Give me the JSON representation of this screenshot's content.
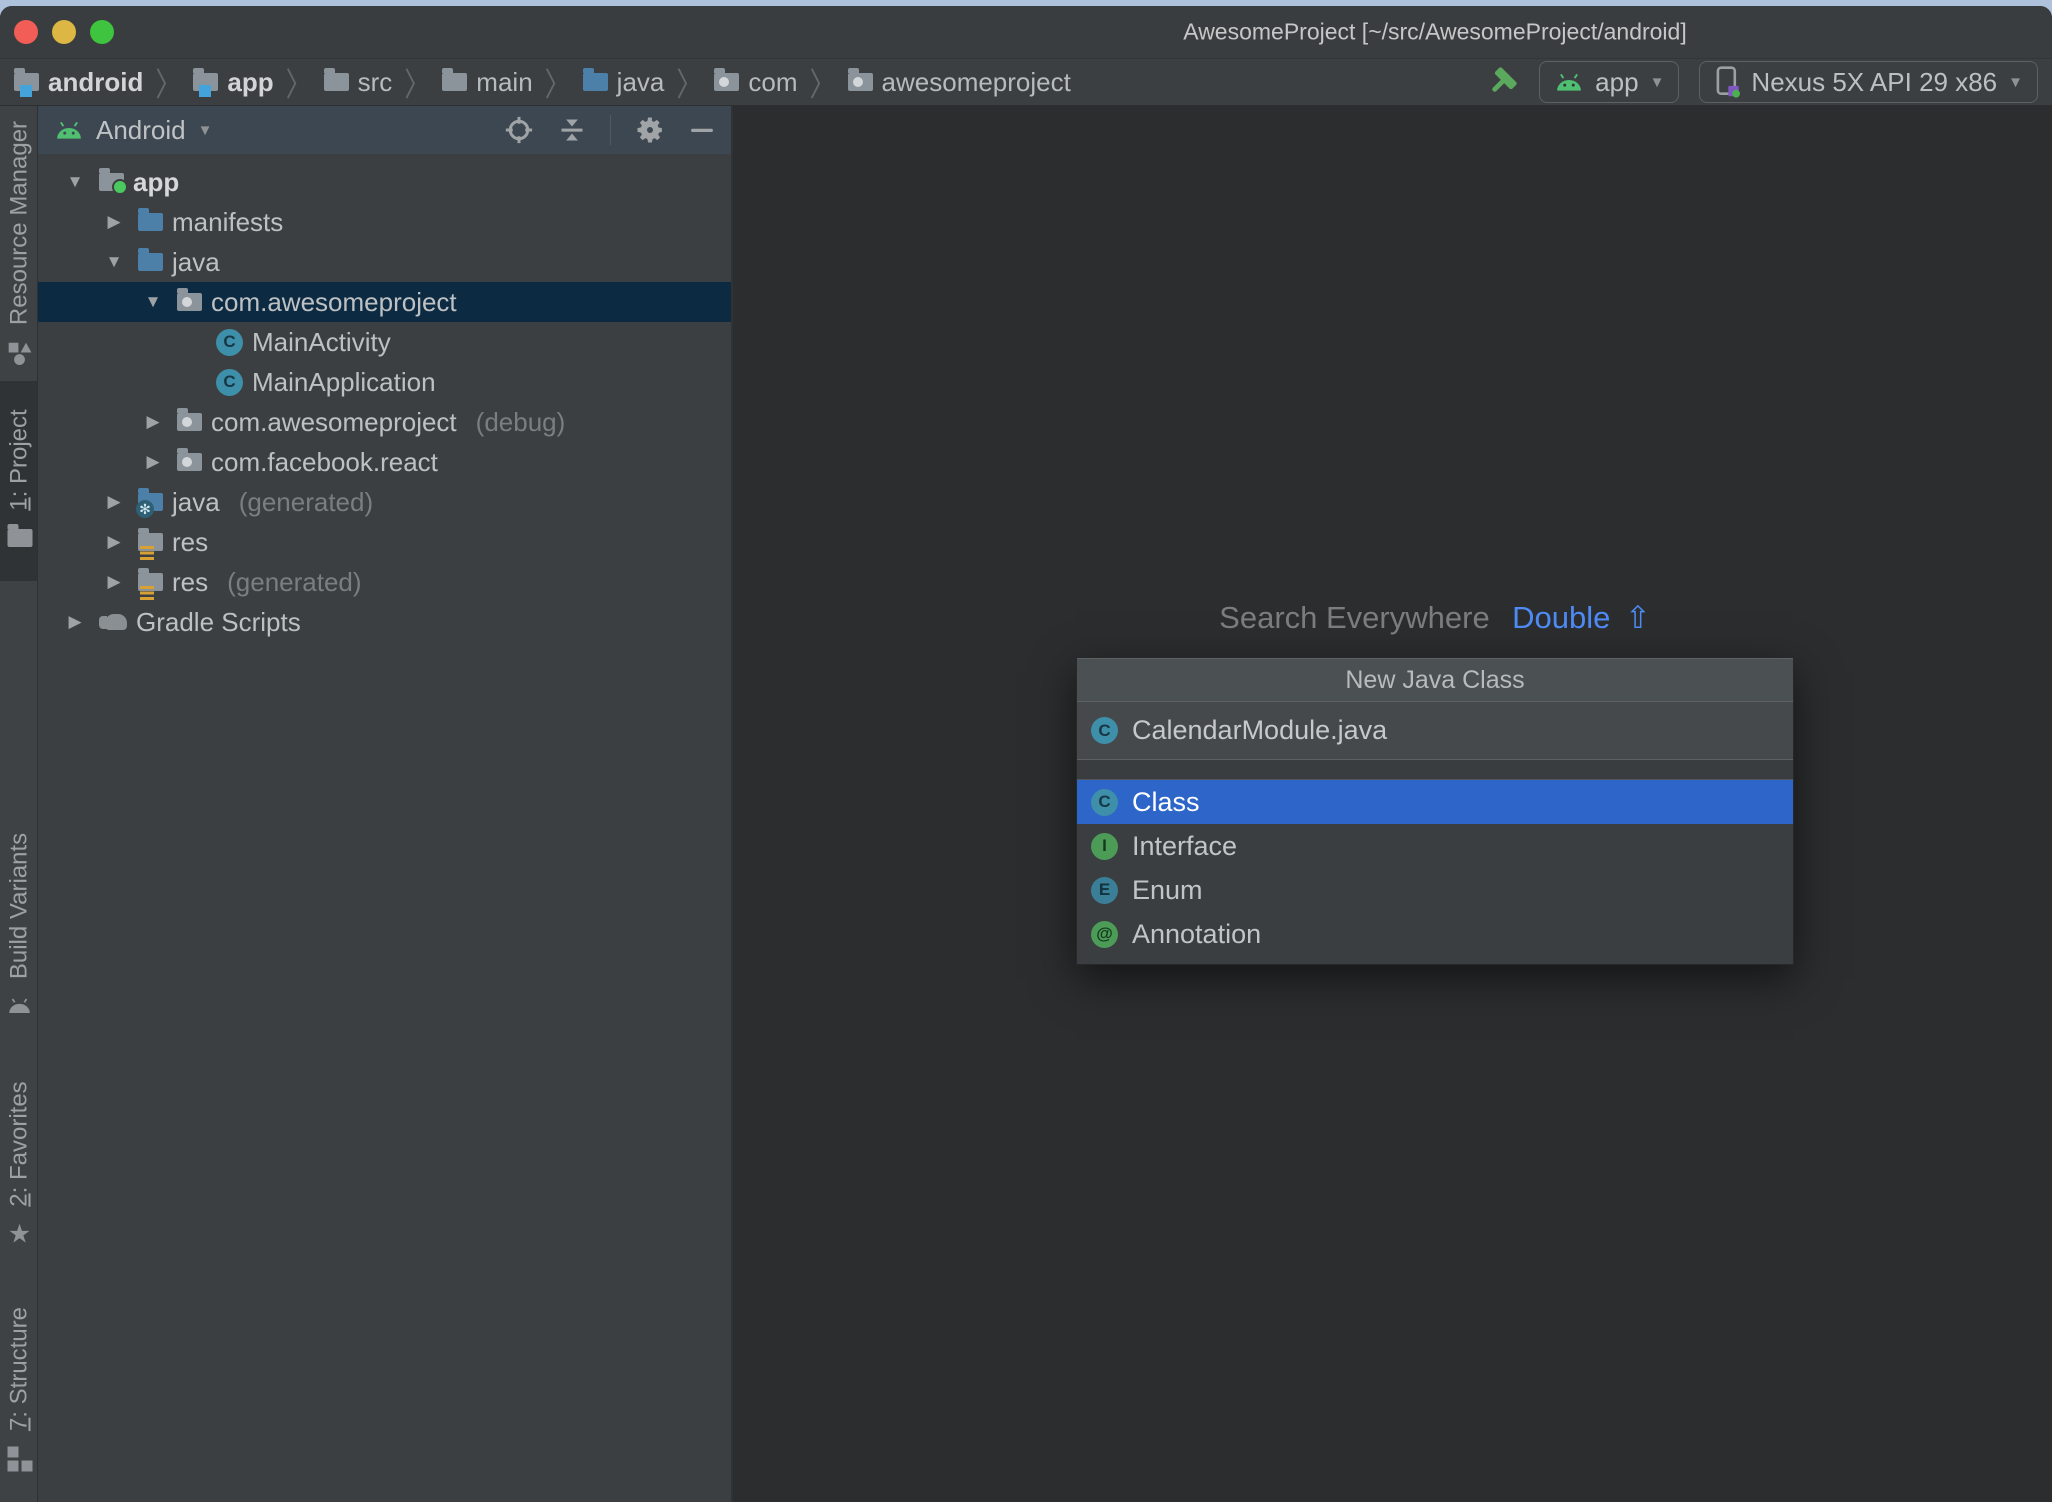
{
  "window": {
    "title": "AwesomeProject [~/src/AwesomeProject/android]"
  },
  "breadcrumbs": [
    {
      "label": "android",
      "icon": "folder-mod",
      "bold": true
    },
    {
      "label": "app",
      "icon": "folder-mod",
      "bold": true
    },
    {
      "label": "src",
      "icon": "folder",
      "bold": false
    },
    {
      "label": "main",
      "icon": "folder",
      "bold": false
    },
    {
      "label": "java",
      "icon": "folder-blue",
      "bold": false
    },
    {
      "label": "com",
      "icon": "folder-pkg",
      "bold": false
    },
    {
      "label": "awesomeproject",
      "icon": "folder-pkg",
      "bold": false
    }
  ],
  "toolbar": {
    "build_icon": "hammer-icon",
    "run_config": "app",
    "device": "Nexus 5X API 29 x86"
  },
  "tool_strip": {
    "top": [
      {
        "label": "Resource Manager",
        "icon": "shapes",
        "active": false,
        "mnemonic": false
      },
      {
        "label": "1: Project",
        "icon": "folder",
        "active": true,
        "mnemonic": true
      }
    ],
    "bottom": [
      {
        "label": "Build Variants",
        "icon": "android",
        "active": false,
        "mnemonic": false
      },
      {
        "label": "2: Favorites",
        "icon": "star",
        "active": false,
        "mnemonic": true
      },
      {
        "label": "7: Structure",
        "icon": "structure",
        "active": false,
        "mnemonic": true
      }
    ]
  },
  "project_panel": {
    "view_selector": "Android",
    "tree": [
      {
        "label": "app",
        "hint": "",
        "icon": "folder-app",
        "arrow": "down",
        "indent": 0,
        "selected": false,
        "bold": true
      },
      {
        "label": "manifests",
        "hint": "",
        "icon": "folder-blue",
        "arrow": "right",
        "indent": 1,
        "selected": false,
        "bold": false
      },
      {
        "label": "java",
        "hint": "",
        "icon": "folder-blue",
        "arrow": "down",
        "indent": 1,
        "selected": false,
        "bold": false
      },
      {
        "label": "com.awesomeproject",
        "hint": "",
        "icon": "folder-pkg",
        "arrow": "down",
        "indent": 2,
        "selected": true,
        "bold": false
      },
      {
        "label": "MainActivity",
        "hint": "",
        "icon": "class",
        "arrow": "none",
        "indent": 3,
        "selected": false,
        "bold": false
      },
      {
        "label": "MainApplication",
        "hint": "",
        "icon": "class",
        "arrow": "none",
        "indent": 3,
        "selected": false,
        "bold": false
      },
      {
        "label": "com.awesomeproject",
        "hint": "(debug)",
        "icon": "folder-pkg",
        "arrow": "right",
        "indent": 2,
        "selected": false,
        "bold": false
      },
      {
        "label": "com.facebook.react",
        "hint": "",
        "icon": "folder-pkg",
        "arrow": "right",
        "indent": 2,
        "selected": false,
        "bold": false
      },
      {
        "label": "java",
        "hint": "(generated)",
        "icon": "folder-gen",
        "arrow": "right",
        "indent": 1,
        "selected": false,
        "bold": false
      },
      {
        "label": "res",
        "hint": "",
        "icon": "folder-res",
        "arrow": "right",
        "indent": 1,
        "selected": false,
        "bold": false
      },
      {
        "label": "res",
        "hint": "(generated)",
        "icon": "folder-res",
        "arrow": "right",
        "indent": 1,
        "selected": false,
        "bold": false
      },
      {
        "label": "Gradle Scripts",
        "hint": "",
        "icon": "gradle",
        "arrow": "right",
        "indent": 0,
        "selected": false,
        "bold": false
      }
    ]
  },
  "editor": {
    "hint_text": "Search Everywhere",
    "hint_shortcut": "Double",
    "hint_key": "⇧"
  },
  "popup": {
    "title": "New Java Class",
    "input_value": "CalendarModule.java",
    "input_icon": "class",
    "items": [
      {
        "label": "Class",
        "icon": "class",
        "selected": true
      },
      {
        "label": "Interface",
        "icon": "interface",
        "selected": false
      },
      {
        "label": "Enum",
        "icon": "enum",
        "selected": false
      },
      {
        "label": "Annotation",
        "icon": "annotation",
        "selected": false
      }
    ]
  },
  "colors": {
    "selection_blue": "#2d65c9",
    "tree_selection_navy": "#0c2a42",
    "android_green": "#4fbf71",
    "hammer_green": "#5aa95c",
    "shortcut_blue": "#4e8bf5",
    "blue_folder": "#4d80a8",
    "res_orange": "#d8a133",
    "class_teal": "#3e8faa",
    "symbol_green": "#4c9b57",
    "panel_bg": "#3b3f42",
    "editor_bg": "#2b2d2e"
  }
}
